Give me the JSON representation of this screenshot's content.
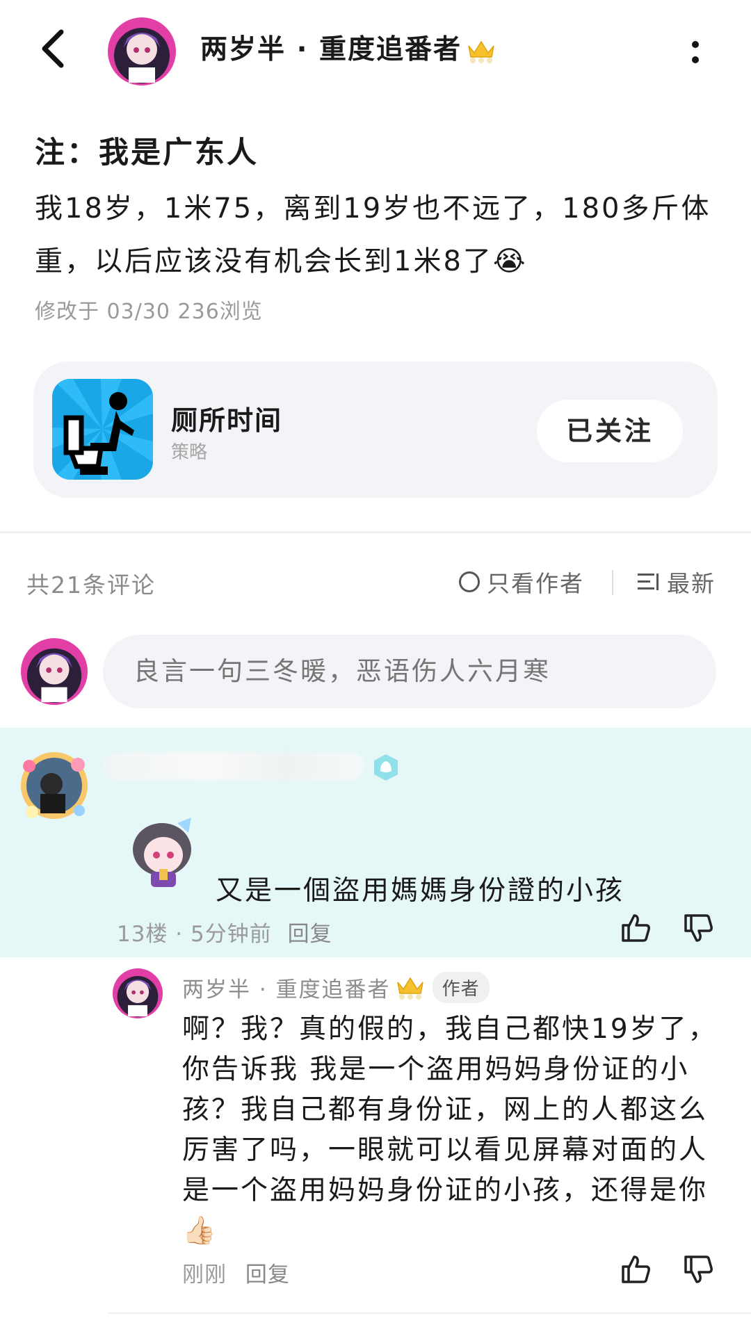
{
  "header": {
    "username": "两岁半 · 重度追番者",
    "crown_icon": "crown-icon",
    "back_icon": "chevron-left-icon",
    "more_icon": "more-vertical-icon"
  },
  "post": {
    "title": "注：我是广东人",
    "body": "我18岁，1米75，离到19岁也不远了，180多斤体重，以后应该没有机会长到1米8了😭",
    "meta": "修改于 03/30 236浏览"
  },
  "game_card": {
    "name": "厕所时间",
    "category": "策略",
    "follow_label": "已关注"
  },
  "comments_bar": {
    "count_label": "共21条评论",
    "only_author_label": "只看作者",
    "sort_label": "最新"
  },
  "comment_input": {
    "placeholder": "良言一句三冬暖，恶语伤人六月寒"
  },
  "comments": [
    {
      "text": "又是一個盜用媽媽身份證的小孩",
      "floor_time": "13楼 · 5分钟前",
      "reply_label": "回复"
    }
  ],
  "reply": {
    "username": "两岁半 · 重度追番者",
    "author_tag": "作者",
    "text": "啊？我？真的假的，我自己都快19岁了，你告诉我 我是一个盗用妈妈身份证的小孩？我自己都有身份证，网上的人都这么厉害了吗，一眼就可以看见屏幕对面的人是一个盗用妈妈身份证的小孩，还得是你👍🏻",
    "time": "刚刚",
    "reply_label": "回复"
  },
  "colors": {
    "highlight_bg": "#e6f7f7",
    "card_bg": "#f2f4f7",
    "muted_text": "#9a9a9a"
  }
}
